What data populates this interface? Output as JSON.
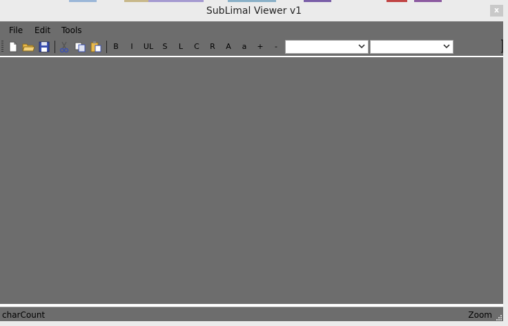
{
  "window": {
    "title": "SubLimal Viewer v1",
    "close_label": "x"
  },
  "menu": {
    "items": [
      "File",
      "Edit",
      "Tools"
    ]
  },
  "toolbar": {
    "format_buttons": [
      "B",
      "I",
      "UL",
      "S",
      "L",
      "C",
      "R",
      "A",
      "a",
      "+",
      "-"
    ],
    "font_combo_value": "",
    "size_combo_value": ""
  },
  "status": {
    "left": "charCount",
    "right": "Zoom"
  },
  "colors": {
    "workspace": "#6d6d6d",
    "chrome": "#ebebeb",
    "close_bg": "#c9c9c9"
  },
  "icons": [
    "new-file-icon",
    "open-folder-icon",
    "save-disk-icon",
    "cut-scissors-icon",
    "copy-icon",
    "paste-icon"
  ]
}
